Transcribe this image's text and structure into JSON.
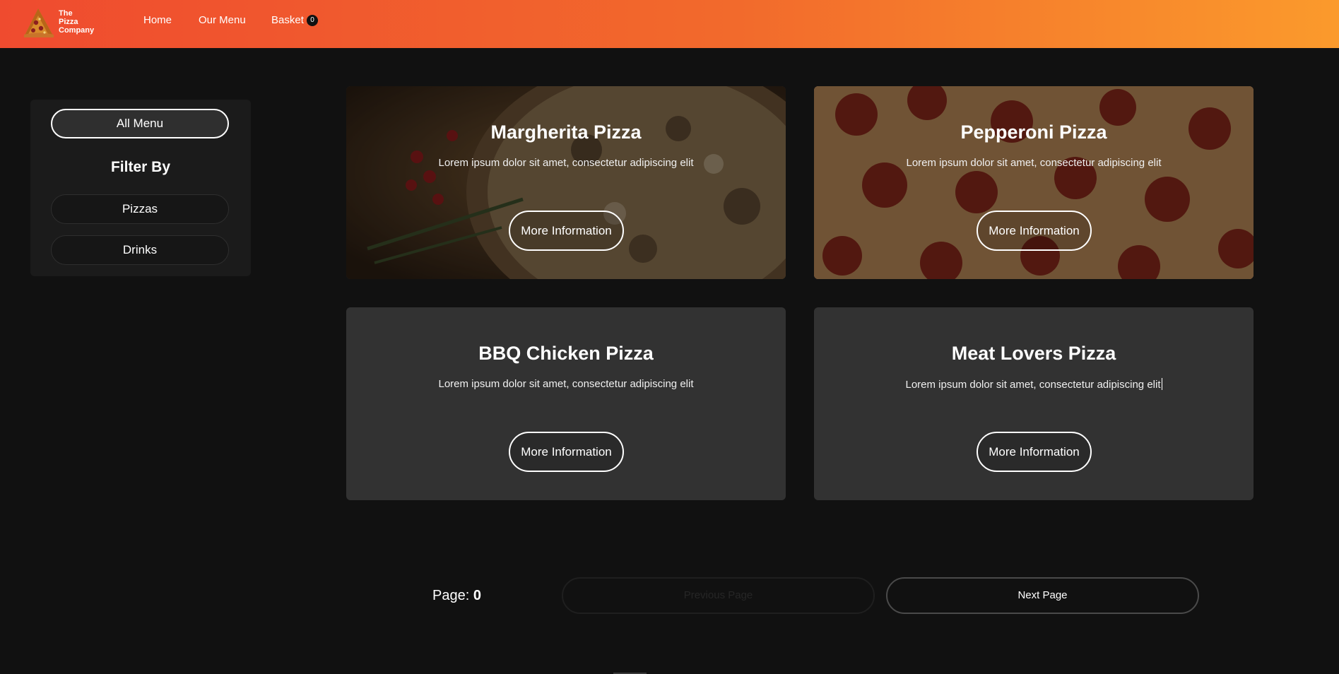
{
  "header": {
    "logo_lines": [
      "The",
      "Pizza",
      "Company"
    ],
    "nav": [
      "Home",
      "Our Menu",
      "Basket"
    ],
    "basket_count": "0"
  },
  "sidebar": {
    "all_menu": "All Menu",
    "filter_title": "Filter By",
    "filters": [
      "Pizzas",
      "Drinks"
    ]
  },
  "cards": [
    {
      "title": "Margherita Pizza",
      "description": "Lorem ipsum dolor sit amet, consectetur adipiscing elit",
      "button": "More Information"
    },
    {
      "title": "Pepperoni Pizza",
      "description": "Lorem ipsum dolor sit amet, consectetur adipiscing elit",
      "button": "More Information"
    },
    {
      "title": "BBQ Chicken Pizza",
      "description": "Lorem ipsum dolor sit amet, consectetur adipiscing elit",
      "button": "More Information"
    },
    {
      "title": "Meat Lovers Pizza",
      "description": "Lorem ipsum dolor sit amet, consectetur adipiscing elit",
      "button": "More Information"
    }
  ],
  "pagination": {
    "label": "Page:",
    "number": "0",
    "previous": "Previous Page",
    "next": "Next Page"
  },
  "colors": {
    "header_start": "#ef4b2f",
    "header_end": "#fb9a2c",
    "background": "#111111",
    "card": "#323232"
  }
}
